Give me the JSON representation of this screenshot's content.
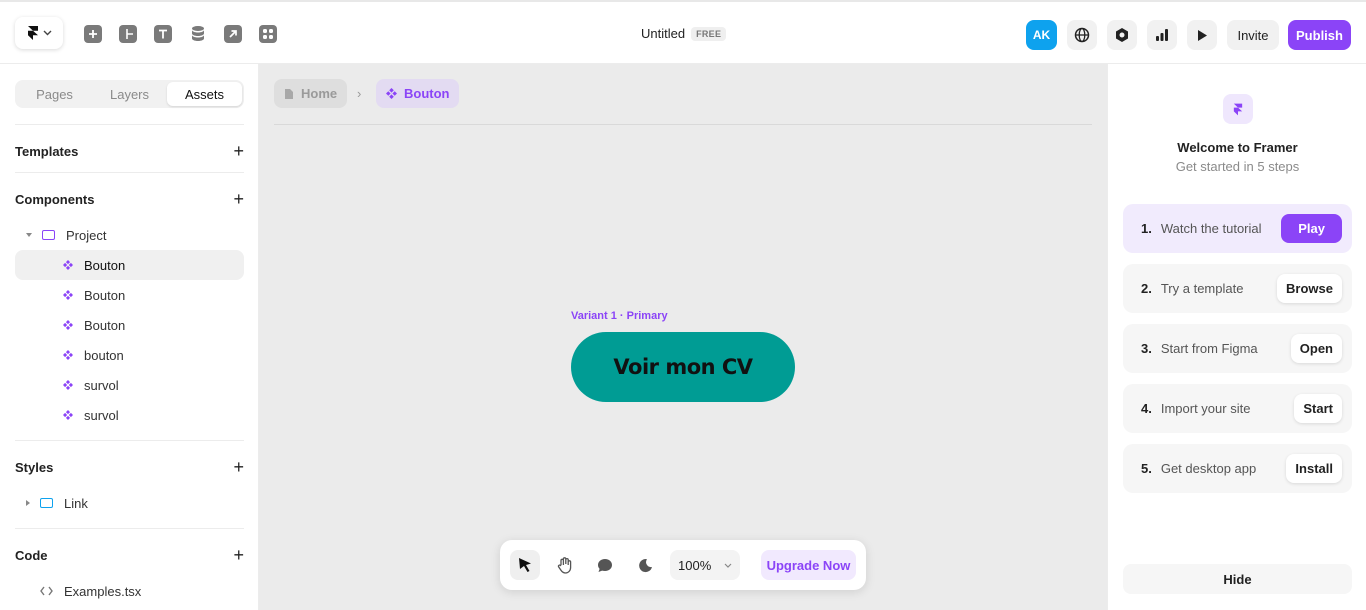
{
  "colors": {
    "accent": "#8b44f7",
    "avatar_bg": "#0ea2ee",
    "canvas_bg": "#ebebeb",
    "cv_button_bg": "#009c94"
  },
  "topbar": {
    "title": "Untitled",
    "plan_badge": "FREE",
    "tools": [
      "insert-icon",
      "layout-icon",
      "text-icon",
      "cms-icon",
      "link-arrow-icon",
      "plugins-icon"
    ],
    "avatar_initials": "AK",
    "right_icons": [
      "globe-icon",
      "settings-hexagon-icon",
      "analytics-icon",
      "play-icon"
    ],
    "invite_label": "Invite",
    "publish_label": "Publish"
  },
  "left_panel": {
    "tabs": [
      {
        "label": "Pages",
        "active": false
      },
      {
        "label": "Layers",
        "active": false
      },
      {
        "label": "Assets",
        "active": true
      }
    ],
    "sections": {
      "templates": "Templates",
      "components": "Components",
      "styles": "Styles",
      "code": "Code"
    },
    "components_tree": {
      "folder": "Project",
      "items": [
        "Bouton",
        "Bouton",
        "Bouton",
        "bouton",
        "survol",
        "survol"
      ]
    },
    "styles_tree": {
      "folder": "Link"
    },
    "code_tree": {
      "file": "Examples.tsx"
    }
  },
  "canvas": {
    "breadcrumb": {
      "home": "Home",
      "current": "Bouton"
    },
    "variant_label": "Variant 1 · Primary",
    "cv_button_text": "Voir mon CV",
    "toolbar": {
      "tools": [
        "cursor-icon",
        "hand-icon",
        "comment-icon",
        "dark-mode-icon"
      ],
      "zoom": "100%",
      "upgrade_label": "Upgrade Now"
    }
  },
  "right_panel": {
    "title": "Welcome to Framer",
    "subtitle": "Get started in 5 steps",
    "steps": [
      {
        "num": "1.",
        "label": "Watch the tutorial",
        "action": "Play"
      },
      {
        "num": "2.",
        "label": "Try a template",
        "action": "Browse"
      },
      {
        "num": "3.",
        "label": "Start from Figma",
        "action": "Open"
      },
      {
        "num": "4.",
        "label": "Import your site",
        "action": "Start"
      },
      {
        "num": "5.",
        "label": "Get desktop app",
        "action": "Install"
      }
    ],
    "hide_label": "Hide"
  }
}
